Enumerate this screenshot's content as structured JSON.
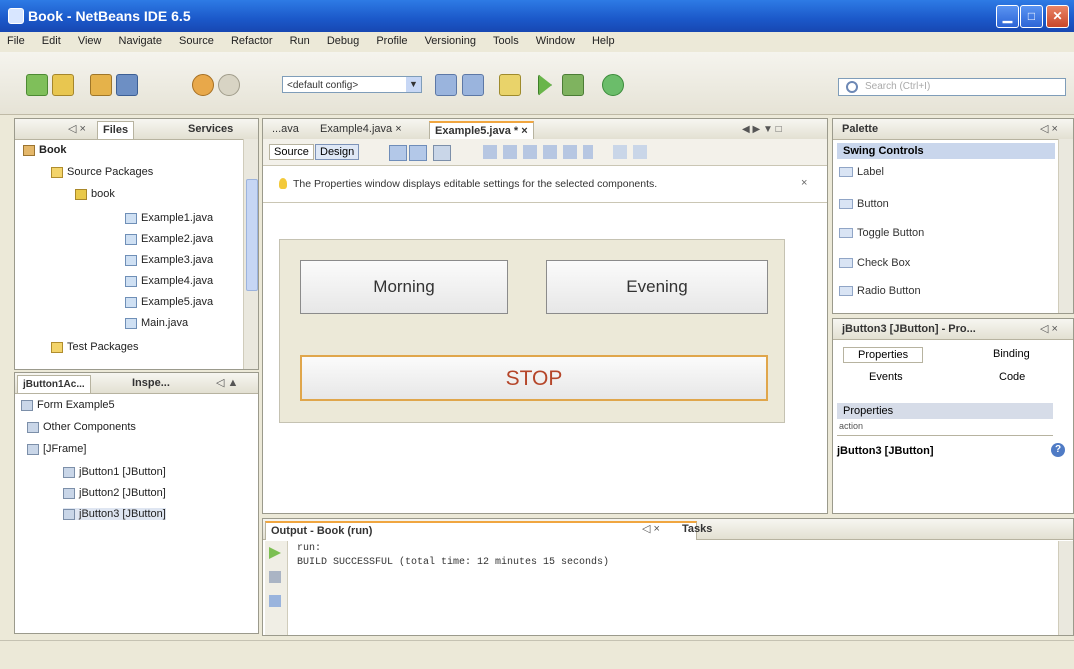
{
  "window": {
    "title": "Book - NetBeans IDE 6.5",
    "min_glyph": "▁",
    "max_glyph": "□",
    "close_glyph": "✕"
  },
  "menu": [
    "File",
    "Edit",
    "View",
    "Navigate",
    "Source",
    "Refactor",
    "Run",
    "Debug",
    "Profile",
    "Versioning",
    "Tools",
    "Window",
    "Help"
  ],
  "toolbar": {
    "config": "<default config>",
    "config_arrow": "▼",
    "search_placeholder": "Search (Ctrl+I)"
  },
  "projects_panel": {
    "tabs": [
      "Files",
      "Services"
    ],
    "controls": "◁ ×",
    "tree": [
      {
        "label": "Book",
        "icon": "project-icon"
      },
      {
        "label": "Source Packages",
        "icon": "folder-icon"
      },
      {
        "label": "book",
        "icon": "package-icon"
      },
      {
        "label": "Example1.java",
        "icon": "java-file-icon"
      },
      {
        "label": "Example2.java",
        "icon": "java-file-icon"
      },
      {
        "label": "Example3.java",
        "icon": "java-file-icon"
      },
      {
        "label": "Example4.java",
        "icon": "java-file-icon"
      },
      {
        "label": "Example5.java",
        "icon": "java-file-icon"
      },
      {
        "label": "Main.java",
        "icon": "java-file-icon"
      },
      {
        "label": "Test Packages",
        "icon": "folder-icon"
      }
    ]
  },
  "inspector_panel": {
    "tabs": [
      "jButton1Ac...",
      "Inspe..."
    ],
    "controls": "◁ ▲",
    "tree": [
      {
        "label": "Form Example5",
        "icon": "form-icon"
      },
      {
        "label": "Other Components",
        "icon": "components-icon"
      },
      {
        "label": "[JFrame]",
        "icon": "frame-icon"
      },
      {
        "label": "jButton1 [JButton]",
        "icon": "button-icon"
      },
      {
        "label": "jButton2 [JButton]",
        "icon": "button-icon"
      },
      {
        "label": "jButton3 [JButton]",
        "icon": "button-icon"
      }
    ]
  },
  "editor": {
    "tabs": [
      "...ava",
      "Example4.java",
      "Example5.java *"
    ],
    "tab_close": "×",
    "tab_controls": "◀ ▶ ▼ □",
    "view_buttons": [
      "Source",
      "Design"
    ],
    "info_message": "The Properties window displays editable settings for the selected components.",
    "info_close": "×",
    "form": {
      "button1": "Morning",
      "button2": "Evening",
      "button3": "STOP"
    }
  },
  "output": {
    "title": "Output - Book (run)",
    "controls": "◁ ×",
    "tasks_tab": "Tasks",
    "lines": [
      "run:",
      "BUILD SUCCESSFUL (total time: 12 minutes 15 seconds)"
    ]
  },
  "palette": {
    "title": "Palette",
    "controls": "◁ ×",
    "category": "Swing Controls",
    "items": [
      "Label",
      "Button",
      "Toggle Button",
      "Check Box",
      "Radio Button"
    ]
  },
  "properties": {
    "title": "jButton3 [JButton] - Pro...",
    "controls": "◁ ×",
    "tabs": [
      "Properties",
      "Binding",
      "Events",
      "Code"
    ],
    "section": "Properties",
    "row_label": "action",
    "selected": "jButton3 [JButton]",
    "help_glyph": "?"
  },
  "colors": {
    "titlebar": "#1b58c9",
    "stop_text": "#b5462a",
    "tab_accent": "#f0a640"
  }
}
